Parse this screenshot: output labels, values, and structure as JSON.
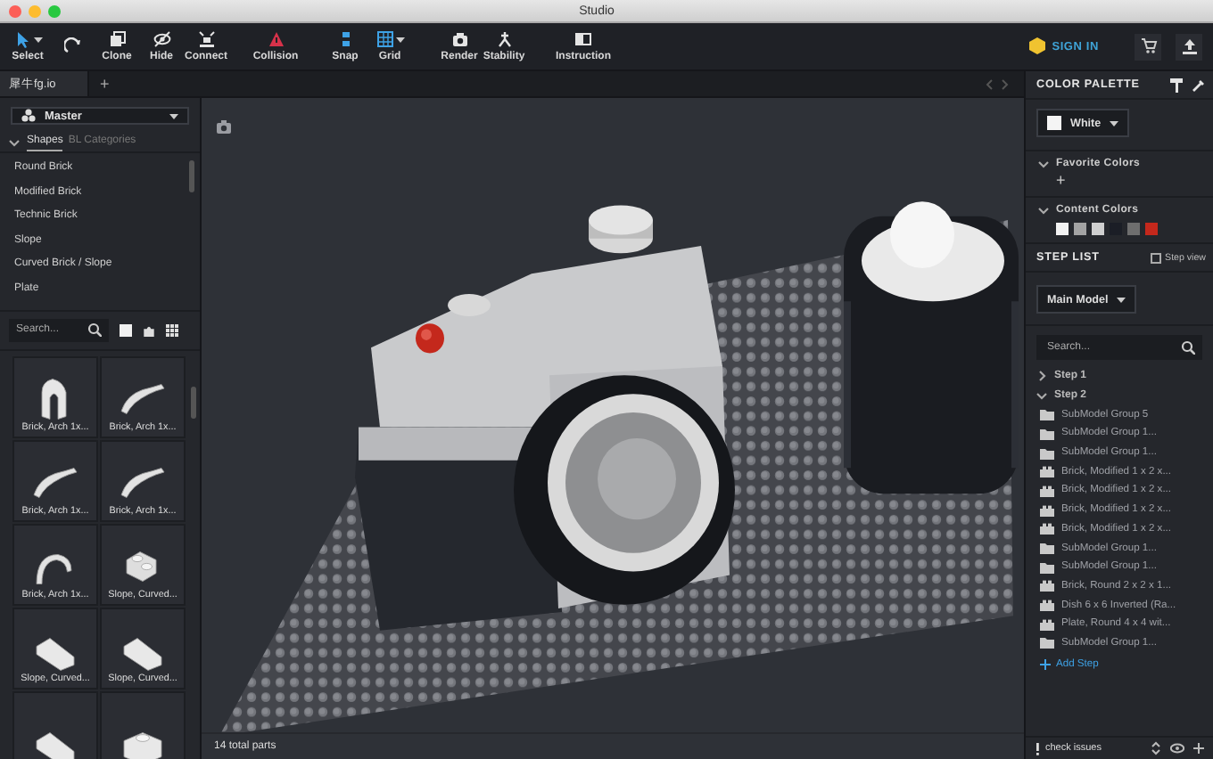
{
  "window": {
    "title": "Studio"
  },
  "toolbar": {
    "groups": [
      [
        {
          "label": "Select",
          "active": true,
          "dropdown": true
        },
        {
          "active": false,
          "dropdown": false
        },
        {
          "label": "Clone",
          "active": false,
          "dropdown": false
        },
        {
          "label": "Hide",
          "active": false,
          "dropdown": false
        },
        {
          "label": "Connect",
          "active": false,
          "dropdown": false
        }
      ],
      [
        {
          "label": "Collision",
          "active": false,
          "dropdown": false
        }
      ],
      [
        {
          "label": "Snap",
          "active": true,
          "dropdown": false
        },
        {
          "label": "Grid",
          "active": true,
          "dropdown": true
        }
      ],
      [
        {
          "label": "Render",
          "active": false,
          "dropdown": false
        },
        {
          "label": "Stability",
          "active": false,
          "dropdown": false
        }
      ],
      [
        {
          "label": "Instruction",
          "active": false,
          "dropdown": false
        }
      ]
    ]
  },
  "account": {
    "sign_in": "SIGN IN"
  },
  "document_tabs": [
    {
      "label": "犀牛fg.io",
      "selected": true
    }
  ],
  "new_tab": "+",
  "left_panel": {
    "model_select": "Master",
    "tabs": [
      {
        "label": "Shapes",
        "selected": true
      },
      {
        "label": "BL Categories",
        "selected": false
      }
    ],
    "categories": [
      "Round Brick",
      "Modified Brick",
      "Technic Brick",
      "Slope",
      "Curved Brick / Slope",
      "Plate"
    ],
    "search": {
      "placeholder": "Search..."
    },
    "parts": [
      {
        "kind": "arch-frame",
        "label": "Brick, Arch 1x..."
      },
      {
        "kind": "arch",
        "label": "Brick, Arch 1x..."
      },
      {
        "kind": "arch",
        "label": "Brick, Arch 1x..."
      },
      {
        "kind": "arch",
        "label": "Brick, Arch 1x..."
      },
      {
        "kind": "arch-round",
        "label": "Brick, Arch 1x..."
      },
      {
        "kind": "double-slope",
        "label": "Slope, Curved..."
      },
      {
        "kind": "slope",
        "label": "Slope, Curved..."
      },
      {
        "kind": "slope",
        "label": "Slope, Curved..."
      },
      {
        "kind": "slope"
      },
      {
        "kind": "brick"
      }
    ]
  },
  "viewport": {
    "parts_count": "14 total parts"
  },
  "color_palette": {
    "title": "COLOR PALETTE",
    "current_color": "White",
    "favorite_colors": {
      "title": "Favorite Colors",
      "expanded": true,
      "add": "+"
    },
    "content_colors": {
      "title": "Content Colors",
      "expanded": true,
      "swatches": [
        {
          "color": "#f2f2f2"
        },
        {
          "color": "#a3a3a3"
        },
        {
          "color": "#cfcfcf"
        },
        {
          "color": "#1b1e26"
        },
        {
          "color": "#6e6e6e"
        },
        {
          "color": "#c4281c"
        }
      ]
    }
  },
  "step_list": {
    "title": "STEP LIST",
    "step_view": {
      "label": "Step view",
      "checked": false
    },
    "model_select": "Main Model",
    "search": {
      "placeholder": "Search..."
    },
    "steps": [
      {
        "label": "Step 1",
        "expanded": false
      },
      {
        "label": "Step 2",
        "expanded": true,
        "children": [
          {
            "kind": "folder",
            "label": "SubModel Group 5"
          },
          {
            "kind": "folder",
            "label": "SubModel Group 1..."
          },
          {
            "kind": "folder",
            "label": "SubModel Group 1..."
          },
          {
            "kind": "part",
            "label": "Brick, Modified 1 x 2 x..."
          },
          {
            "kind": "part",
            "label": "Brick, Modified 1 x 2 x..."
          },
          {
            "kind": "part",
            "label": "Brick, Modified 1 x 2 x..."
          },
          {
            "kind": "part",
            "label": "Brick, Modified 1 x 2 x..."
          },
          {
            "kind": "folder",
            "label": "SubModel Group 1..."
          },
          {
            "kind": "folder",
            "label": "SubModel Group 1..."
          },
          {
            "kind": "part",
            "label": "Brick, Round 2 x 2 x 1..."
          },
          {
            "kind": "part",
            "label": "Dish 6 x 6 Inverted (Ra..."
          },
          {
            "kind": "part",
            "label": "Plate, Round 4 x 4 wit..."
          },
          {
            "kind": "folder",
            "label": "SubModel Group 1..."
          }
        ]
      }
    ],
    "add_step": "Add Step"
  },
  "status": {
    "check_issues": "check issues"
  }
}
